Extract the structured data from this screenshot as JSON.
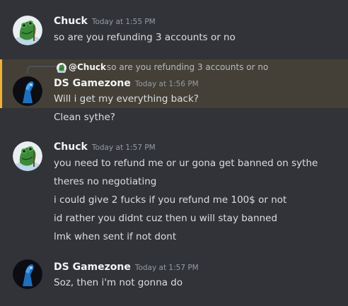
{
  "messages": [
    {
      "author": "Chuck",
      "timestamp": "Today at 1:55 PM",
      "avatar": "frog-avatar",
      "lines": [
        "so are you refunding 3 accounts or no"
      ]
    },
    {
      "author": "DS Gamezone",
      "timestamp": "Today at 1:56 PM",
      "avatar": "blue-figure-avatar",
      "reply_to": {
        "author": "@Chuck",
        "text": "so are you refunding 3 accounts or no"
      },
      "highlighted": true,
      "lines": [
        "Will i get my everything back?",
        "Clean sythe?"
      ]
    },
    {
      "author": "Chuck",
      "timestamp": "Today at 1:57 PM",
      "avatar": "frog-avatar",
      "lines": [
        "you need to refund me or ur gona get banned on sythe",
        "theres no negotiating",
        "i could give 2 fucks if you refund me 100$ or not",
        "id rather you didnt cuz then u will stay banned",
        "lmk when sent if not dont"
      ]
    },
    {
      "author": "DS Gamezone",
      "timestamp": "Today at 1:57 PM",
      "avatar": "blue-figure-avatar",
      "lines": [
        "Soz, then i'm not gonna do"
      ]
    }
  ],
  "colors": {
    "background": "#313338",
    "highlight": "#444037",
    "highlight_bar": "#f0b232"
  }
}
